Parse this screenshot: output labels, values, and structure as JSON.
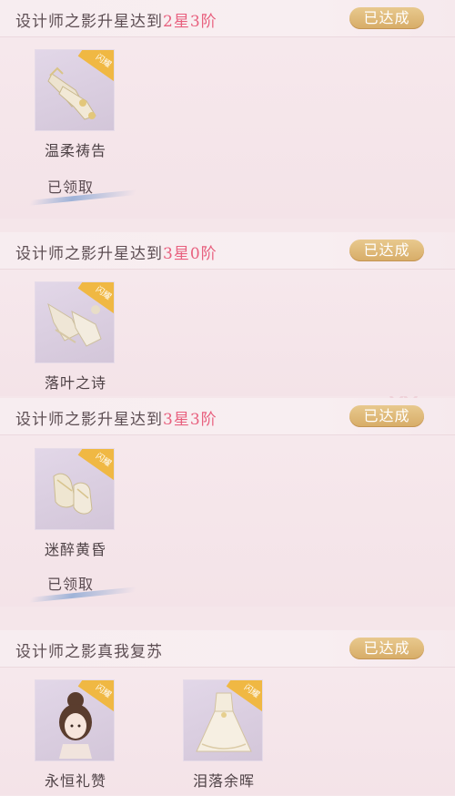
{
  "sections": [
    {
      "title_prefix": "设计师之影升星达到",
      "title_highlight": "2星3阶",
      "status": "已达成",
      "rewards": [
        {
          "name": "温柔祷告",
          "tag": "闪耀",
          "icon": "gloves-icon"
        }
      ],
      "claimed_label": "已领取"
    },
    {
      "title_prefix": "设计师之影升星达到",
      "title_highlight": "3星0阶",
      "status": "已达成",
      "rewards": [
        {
          "name": "落叶之诗",
          "tag": "闪耀",
          "icon": "stockings-icon"
        }
      ]
    },
    {
      "title_prefix": "设计师之影升星达到",
      "title_highlight": "3星3阶",
      "status": "已达成",
      "rewards": [
        {
          "name": "迷醉黄昏",
          "tag": "闪耀",
          "icon": "shoes-icon"
        }
      ],
      "claimed_label": "已领取"
    },
    {
      "title_prefix": "设计师之影真我复苏",
      "title_highlight": "",
      "status": "已达成",
      "rewards": [
        {
          "name": "永恒礼赞",
          "tag": "闪耀",
          "icon": "hairstyle-icon"
        },
        {
          "name": "泪落余晖",
          "tag": "闪耀",
          "icon": "dress-icon"
        }
      ]
    }
  ],
  "colors": {
    "highlight": "#e8607e",
    "badge": "#d7ac67",
    "tag": "#f0b843"
  }
}
